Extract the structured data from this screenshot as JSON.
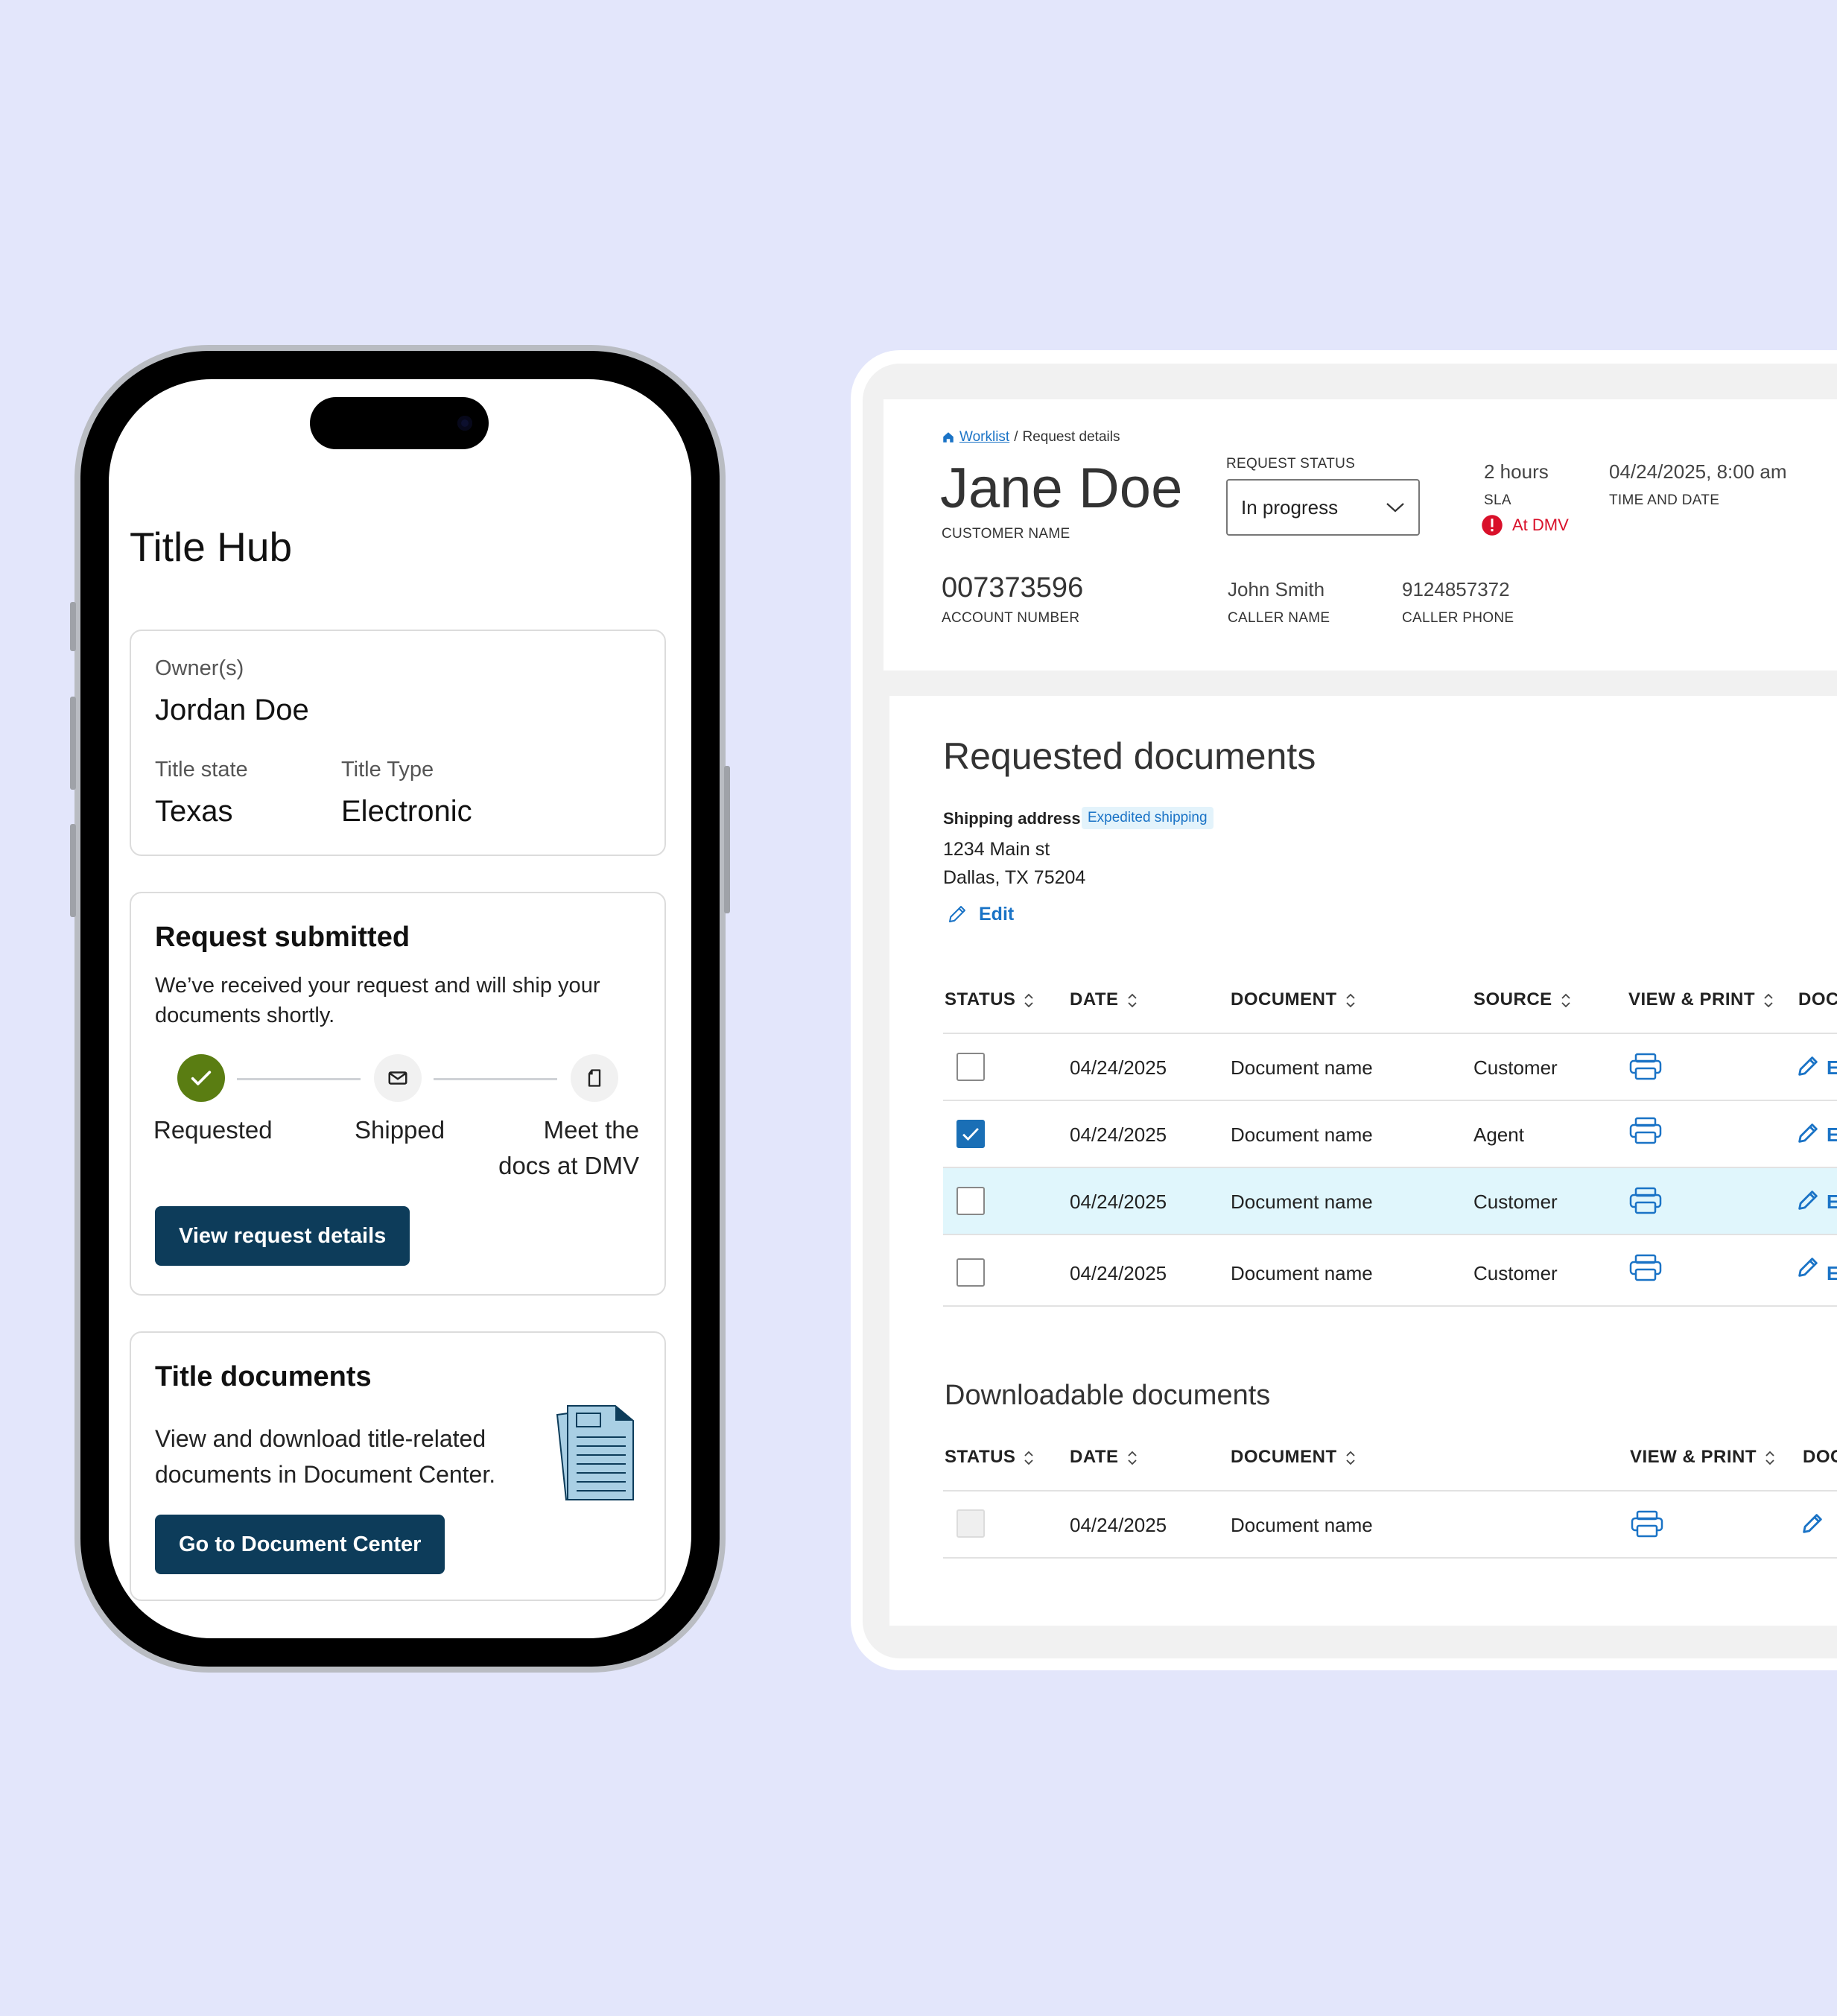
{
  "mobile": {
    "app_title": "Title Hub",
    "owner_card": {
      "owners_label": "Owner(s)",
      "owners_value": "Jordan Doe",
      "title_state_label": "Title state",
      "title_state_value": "Texas",
      "title_type_label": "Title Type",
      "title_type_value": "Electronic"
    },
    "request_card": {
      "heading": "Request submitted",
      "body_line1": "We’ve received your request and will ship your",
      "body_line2": "documents shortly.",
      "steps": [
        {
          "label": "Requested",
          "icon": "check-icon",
          "done": true
        },
        {
          "label": "Shipped",
          "icon": "envelope-icon",
          "done": false
        },
        {
          "label_line1": "Meet the",
          "label_line2": "docs at DMV",
          "icon": "document-icon",
          "done": false
        }
      ],
      "button_label": "View request details"
    },
    "documents_card": {
      "heading": "Title documents",
      "body_line1": "View and download title-related",
      "body_line2": "documents in Document Center.",
      "button_label": "Go to Document Center"
    }
  },
  "desktop": {
    "breadcrumb": {
      "home_link": "Worklist",
      "separator": "/",
      "current": "Request details"
    },
    "customer_name": "Jane Doe",
    "customer_name_label": "CUSTOMER NAME",
    "request_status_label": "REQUEST STATUS",
    "request_status_value": "In progress",
    "sla_value": "2 hours",
    "sla_label": "SLA",
    "sla_alert": "At DMV",
    "time_date_value": "04/24/2025, 8:00 am",
    "time_date_label": "TIME AND DATE",
    "account_number": "007373596",
    "account_number_label": "ACCOUNT NUMBER",
    "caller_name": "John Smith",
    "caller_name_label": "CALLER NAME",
    "caller_phone": "9124857372",
    "caller_phone_label": "CALLER PHONE",
    "requested_documents": {
      "heading": "Requested documents",
      "shipping_label": "Shipping address",
      "shipping_badge": "Expedited shipping",
      "address_line1": "1234 Main st",
      "address_line2": "Dallas, TX 75204",
      "edit_label": "Edit",
      "columns": [
        "STATUS",
        "DATE",
        "DOCUMENT",
        "SOURCE",
        "VIEW & PRINT",
        "DOC"
      ],
      "rows": [
        {
          "checked": false,
          "date": "04/24/2025",
          "document": "Document name",
          "source": "Customer",
          "action_initial": "E",
          "highlighted": false
        },
        {
          "checked": true,
          "date": "04/24/2025",
          "document": "Document name",
          "source": "Agent",
          "action_initial": "E",
          "highlighted": false
        },
        {
          "checked": false,
          "date": "04/24/2025",
          "document": "Document name",
          "source": "Customer",
          "action_initial": "E",
          "highlighted": true
        },
        {
          "checked": false,
          "date": "04/24/2025",
          "document": "Document name",
          "source": "Customer",
          "action_initial": "E",
          "highlighted": false
        }
      ]
    },
    "downloadable_documents": {
      "heading": "Downloadable documents",
      "columns": [
        "STATUS",
        "DATE",
        "DOCUMENT",
        "VIEW & PRINT",
        "DOC"
      ],
      "rows": [
        {
          "checked": false,
          "disabled": true,
          "date": "04/24/2025",
          "document": "Document name"
        }
      ]
    }
  },
  "colors": {
    "background": "#e3e6fb",
    "navy_button": "#0d3c5a",
    "success_green": "#5a7d12",
    "link_blue": "#1a73c6",
    "alert_red": "#d9102a",
    "row_highlight": "#e0f6fc",
    "checkbox_blue": "#1a6fb6"
  }
}
